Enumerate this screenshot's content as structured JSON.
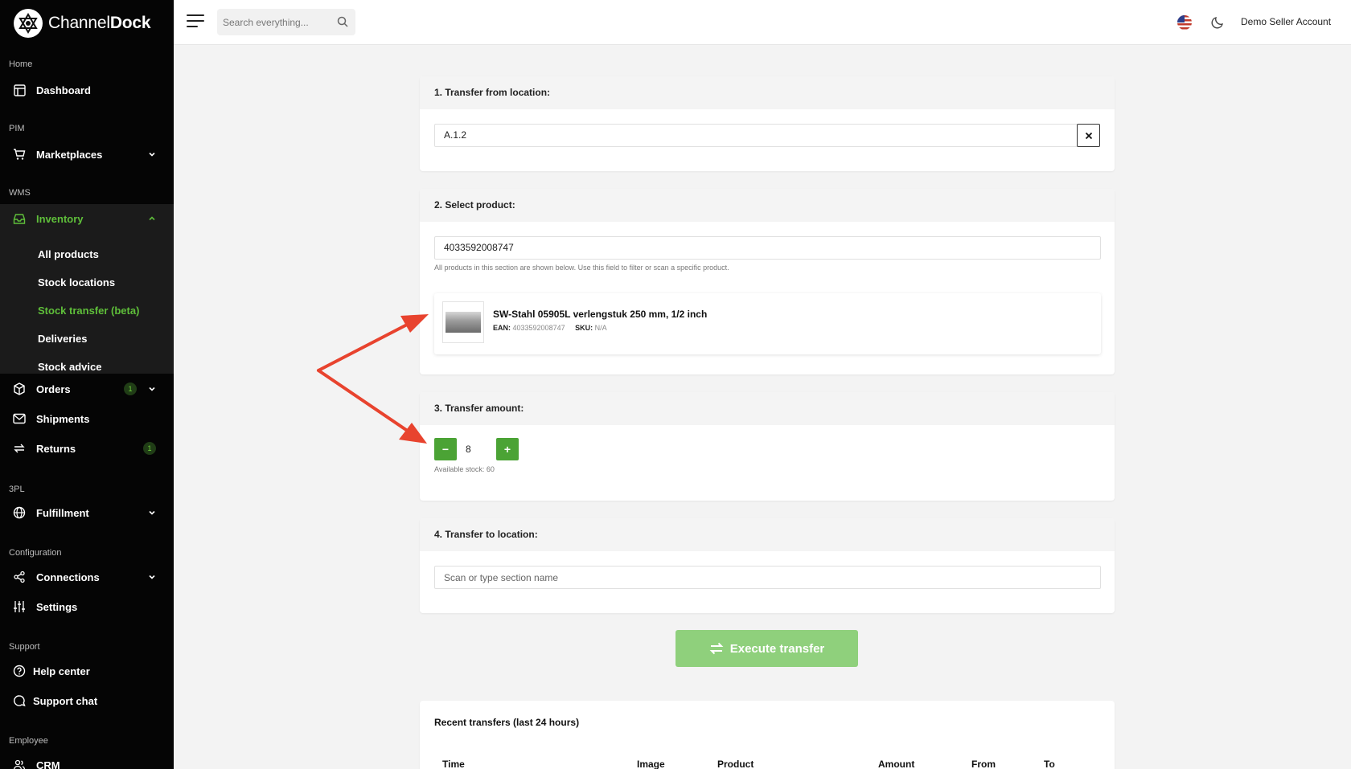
{
  "sidebar": {
    "logo": {
      "text_regular": "Channel",
      "text_bold": "Dock"
    },
    "sections": {
      "home": "Home",
      "pim": "PIM",
      "wms": "WMS",
      "threepl": "3PL",
      "configuration": "Configuration",
      "support": "Support",
      "employee": "Employee"
    },
    "items": {
      "dashboard": "Dashboard",
      "marketplaces": "Marketplaces",
      "inventory": "Inventory",
      "orders": "Orders",
      "orders_badge": "1",
      "shipments": "Shipments",
      "returns": "Returns",
      "returns_badge": "1",
      "fulfillment": "Fulfillment",
      "connections": "Connections",
      "settings": "Settings",
      "help_center": "Help center",
      "support_chat": "Support chat",
      "crm": "CRM"
    },
    "inventory_sub": {
      "all_products": "All products",
      "stock_locations": "Stock locations",
      "stock_transfer": "Stock transfer (beta)",
      "deliveries": "Deliveries",
      "stock_advice": "Stock advice"
    }
  },
  "topbar": {
    "search_placeholder": "Search everything...",
    "account": "Demo Seller Account"
  },
  "from_location": {
    "title": "1. Transfer from location:",
    "value": "A.1.2"
  },
  "select_product": {
    "title": "2. Select product:",
    "value": "4033592008747",
    "hint": "All products in this section are shown below. Use this field to filter or scan a specific product.",
    "product": {
      "name": "SW-Stahl 05905L verlengstuk 250 mm, 1/2 inch",
      "ean_label": "EAN:",
      "ean": "4033592008747",
      "sku_label": "SKU:",
      "sku": "N/A"
    }
  },
  "amount": {
    "title": "3. Transfer amount:",
    "minus": "−",
    "value": "8",
    "plus": "+",
    "available": "Available stock: 60"
  },
  "to_location": {
    "title": "4. Transfer to location:",
    "placeholder": "Scan or type section name"
  },
  "execute_label": "Execute transfer",
  "recent": {
    "title": "Recent transfers (last 24 hours)",
    "columns": [
      "Time",
      "Image",
      "Product",
      "Amount",
      "From",
      "To"
    ]
  },
  "colors": {
    "accent_green": "#4ba335",
    "execute_green": "#8fd07c",
    "annotation_red": "#e8432e"
  }
}
